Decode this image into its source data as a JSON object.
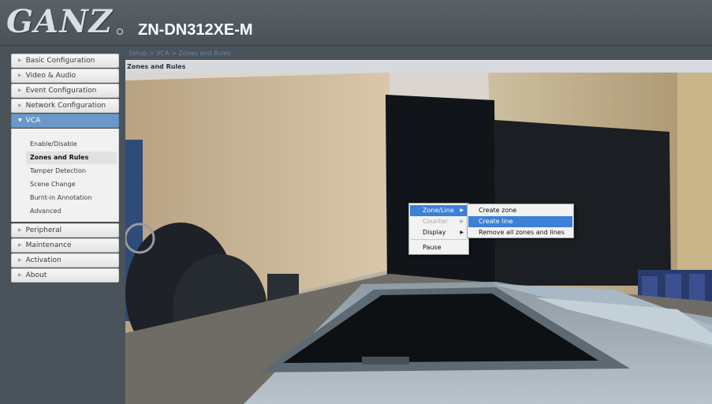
{
  "header": {
    "logo_text": "GANZ",
    "model": "ZN-DN312XE-M"
  },
  "sidebar": {
    "items": [
      {
        "label": "Basic Configuration",
        "name": "sidebar-item-basic-configuration"
      },
      {
        "label": "Video & Audio",
        "name": "sidebar-item-video-audio"
      },
      {
        "label": "Event Configuration",
        "name": "sidebar-item-event-configuration"
      },
      {
        "label": "Network Configuration",
        "name": "sidebar-item-network-configuration"
      },
      {
        "label": "VCA",
        "name": "sidebar-item-vca",
        "active": true
      },
      {
        "label": "Peripheral",
        "name": "sidebar-item-peripheral"
      },
      {
        "label": "Maintenance",
        "name": "sidebar-item-maintenance"
      },
      {
        "label": "Activation",
        "name": "sidebar-item-activation"
      },
      {
        "label": "About",
        "name": "sidebar-item-about"
      }
    ],
    "vca_submenu": [
      {
        "label": "Enable/Disable"
      },
      {
        "label": "Zones and Rules",
        "selected": true
      },
      {
        "label": "Tamper Detection"
      },
      {
        "label": "Scene Change"
      },
      {
        "label": "Burnt-in Annotation"
      },
      {
        "label": "Advanced"
      }
    ]
  },
  "main": {
    "breadcrumb": "Setup > VCA > Zones and Rules",
    "panel_title": "Zones and Rules"
  },
  "context_menu": {
    "items": [
      {
        "label": "Zone/Line",
        "highlighted": true,
        "has_submenu": true
      },
      {
        "label": "Counter",
        "disabled": true,
        "has_submenu": true
      },
      {
        "label": "Display",
        "has_submenu": true
      },
      {
        "label": "Pause"
      }
    ],
    "submenu": [
      {
        "label": "Create zone"
      },
      {
        "label": "Create line",
        "highlighted": true
      },
      {
        "label": "Remove all zones and lines"
      }
    ]
  },
  "colors": {
    "header_bg": "#4b5259",
    "active_nav": "#6b97c9",
    "menu_highlight": "#3c80d8"
  }
}
